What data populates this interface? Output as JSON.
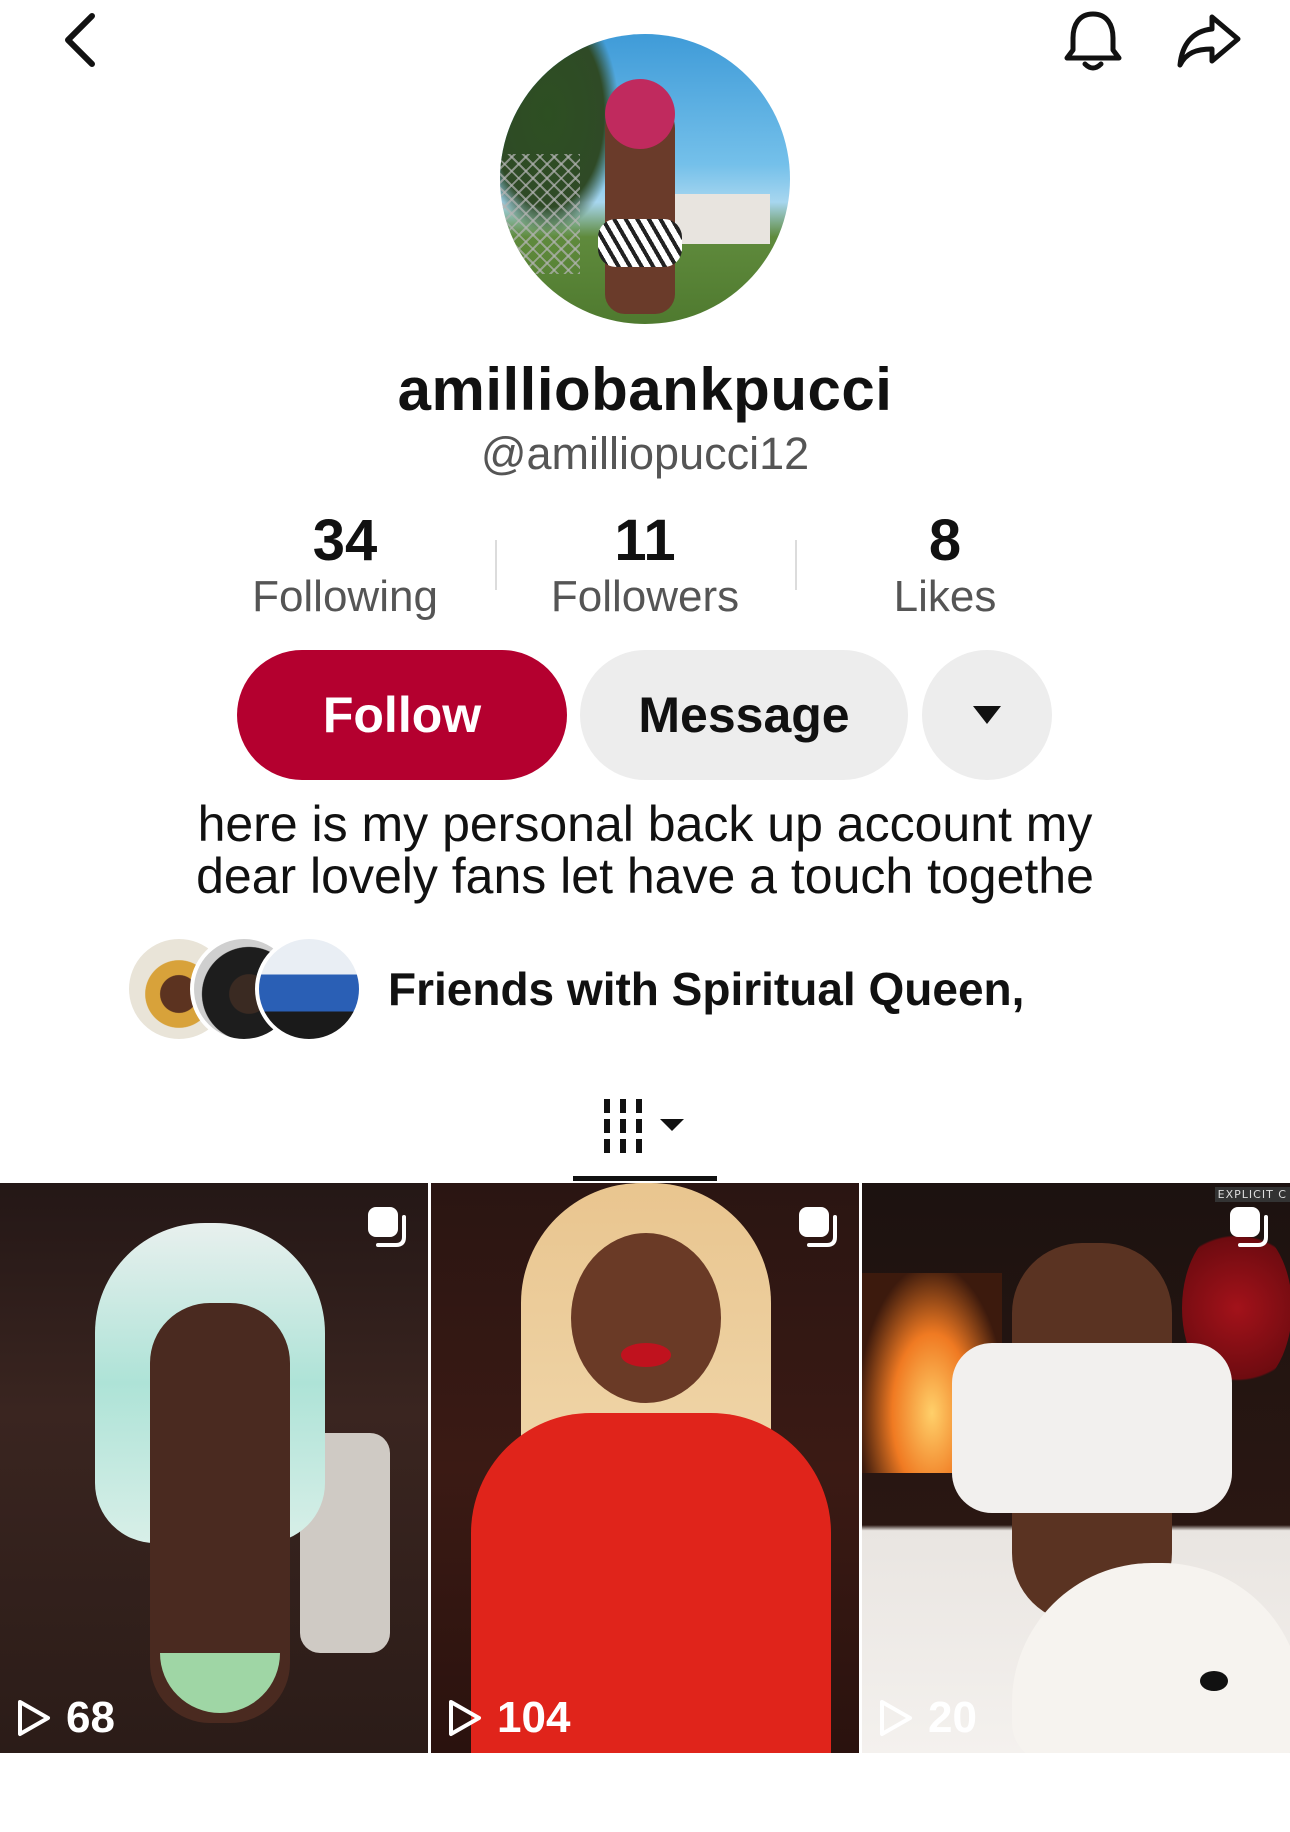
{
  "profile": {
    "display_name": "amilliobankpucci",
    "handle": "@amilliopucci12",
    "bio": "here is my personal back up account my dear lovely fans let have a touch togethe"
  },
  "stats": [
    {
      "value": "34",
      "label": "Following"
    },
    {
      "value": "11",
      "label": "Followers"
    },
    {
      "value": "8",
      "label": "Likes"
    }
  ],
  "actions": {
    "follow_label": "Follow",
    "message_label": "Message",
    "more_icon": "caret-down-icon"
  },
  "friends": {
    "text": "Friends with Spiritual Queen,"
  },
  "tabs": {
    "active": "videos-grid-icon"
  },
  "videos": [
    {
      "views": "68"
    },
    {
      "views": "104"
    },
    {
      "views": "20",
      "badge": "EXPLICIT C"
    }
  ],
  "colors": {
    "follow_button": "#b4002f",
    "secondary_button": "#ededed",
    "text_primary": "#111111",
    "text_secondary": "#555555"
  },
  "icons": {
    "top_left": "back-chevron-icon",
    "top_right_1": "bell-icon",
    "top_right_2": "share-arrow-icon"
  }
}
